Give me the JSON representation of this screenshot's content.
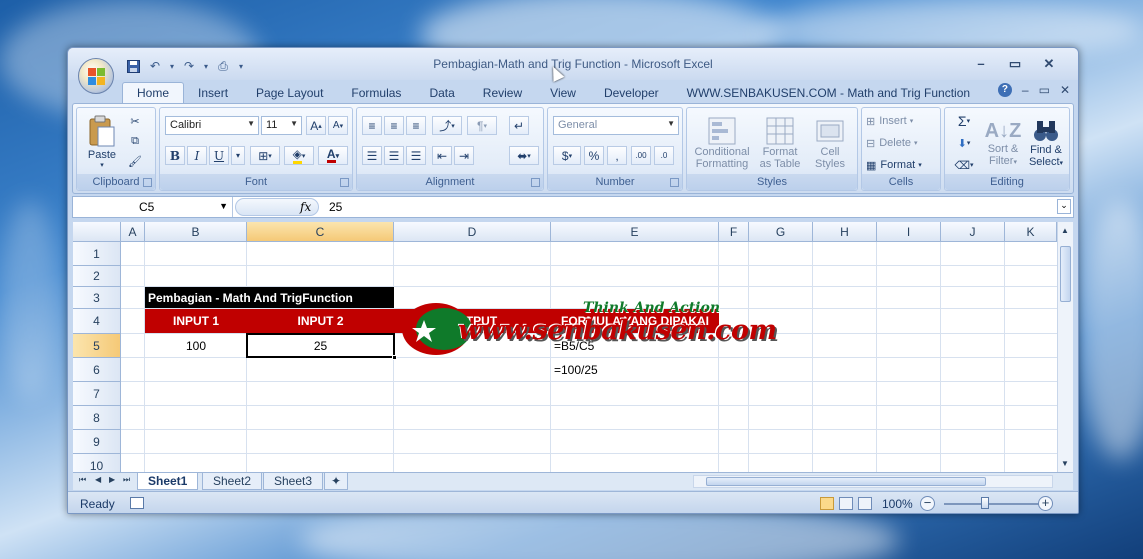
{
  "window": {
    "title": "Pembagian-Math and Trig Function  -  Microsoft Excel"
  },
  "ribbon": {
    "tabs": [
      "Home",
      "Insert",
      "Page Layout",
      "Formulas",
      "Data",
      "Review",
      "View",
      "Developer",
      "WWW.SENBAKUSEN.COM - Math and Trig Function"
    ],
    "active_tab": "Home",
    "clipboard": {
      "paste": "Paste",
      "label": "Clipboard"
    },
    "font": {
      "name": "Calibri",
      "size": "11",
      "label": "Font",
      "bold": "B",
      "italic": "I",
      "underline": "U",
      "grow": "A",
      "shrink": "A",
      "color": "A"
    },
    "alignment": {
      "label": "Alignment"
    },
    "number": {
      "format": "General",
      "label": "Number",
      "currency": "$",
      "percent": "%",
      "comma": ",",
      "inc": ".00",
      "dec": ".0"
    },
    "styles": {
      "conditional": "Conditional",
      "formatting": "Formatting",
      "format": "Format",
      "as_table": "as Table",
      "cell": "Cell",
      "styles_word": "Styles",
      "label": "Styles"
    },
    "cells": {
      "insert": "Insert",
      "delete": "Delete",
      "format": "Format",
      "label": "Cells"
    },
    "editing": {
      "sigma": "Σ",
      "sort": "Sort &",
      "filter": "Filter",
      "find": "Find &",
      "select": "Select",
      "label": "Editing"
    }
  },
  "formula_bar": {
    "name_box": "C5",
    "fx": "fx",
    "value": "25"
  },
  "grid": {
    "columns": [
      "A",
      "B",
      "C",
      "D",
      "E",
      "F",
      "G",
      "H",
      "I",
      "J",
      "K"
    ],
    "selected_column": "C",
    "rows": [
      "1",
      "2",
      "3",
      "4",
      "5",
      "6",
      "7",
      "8",
      "9",
      "10"
    ],
    "selected_row": "5",
    "title_cell": "Pembagian -  Math And TrigFunction",
    "headers": [
      "INPUT 1",
      "INPUT 2",
      "OUTPUT",
      "FORMULA YANG DIPAKAI"
    ],
    "b5": "100",
    "c5": "25",
    "e5": "=B5/C5",
    "e6": "=100/25",
    "header_color": "#c00000"
  },
  "watermark": {
    "tagline": "Think And Action",
    "url": "www.senbakusen.com"
  },
  "sheets": [
    "Sheet1",
    "Sheet2",
    "Sheet3"
  ],
  "active_sheet": "Sheet1",
  "status": {
    "ready": "Ready",
    "zoom": "100%"
  }
}
